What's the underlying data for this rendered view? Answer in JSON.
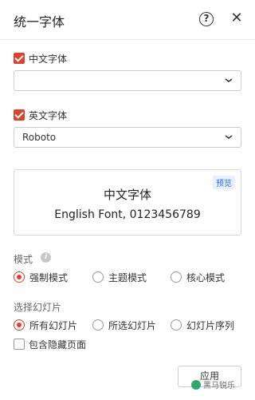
{
  "dialog": {
    "title": "统一字体",
    "help_icon": "help-icon",
    "close_icon": "close-icon"
  },
  "chinese_font": {
    "checkbox_label": "中文字体",
    "checked": true,
    "value": ""
  },
  "english_font": {
    "checkbox_label": "英文字体",
    "checked": true,
    "value": "Roboto"
  },
  "preview": {
    "badge": "预览",
    "line_cn": "中文字体",
    "line_en": "English Font, 0123456789"
  },
  "mode": {
    "label": "模式",
    "options": [
      "强制模式",
      "主题模式",
      "核心模式"
    ],
    "selected": "强制模式"
  },
  "slides": {
    "label": "选择幻灯片",
    "options": [
      "所有幻灯片",
      "所选幻灯片",
      "幻灯片序列"
    ],
    "selected": "所有幻灯片",
    "include_hidden_label": "包含隐藏页面",
    "include_hidden_checked": false
  },
  "apply_label": "应用",
  "watermark": {
    "text": "黑马锐乐"
  },
  "colors": {
    "accent": "#e0412b",
    "badge_bg": "#e8f0fc",
    "badge_text": "#2f6fd6"
  }
}
